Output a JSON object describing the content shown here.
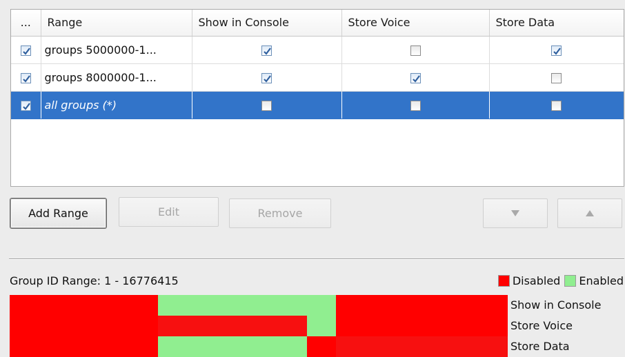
{
  "table": {
    "columns": [
      "...",
      "Range",
      "Show in Console",
      "Store Voice",
      "Store Data"
    ],
    "rows": [
      {
        "enabled": true,
        "range": "groups 5000000-1...",
        "show_in_console": true,
        "store_voice": false,
        "store_data": true,
        "selected": false
      },
      {
        "enabled": true,
        "range": "groups 8000000-1...",
        "show_in_console": true,
        "store_voice": true,
        "store_data": false,
        "selected": false
      },
      {
        "enabled": true,
        "range": "all groups (*)",
        "show_in_console": false,
        "store_voice": false,
        "store_data": false,
        "selected": true
      }
    ]
  },
  "buttons": {
    "add_range": "Add Range",
    "edit": "Edit",
    "remove": "Remove",
    "move_down_icon": "triangle-down",
    "move_up_icon": "triangle-up"
  },
  "range_map": {
    "label": "Group ID Range: 1 - 16776415",
    "legend_disabled": "Disabled",
    "legend_enabled": "Enabled",
    "colors": {
      "disabled": "#ff0000",
      "enabled": "#90ee90"
    },
    "rows": [
      {
        "name": "Show in Console",
        "segments": [
          {
            "from": 0.0,
            "to": 0.298,
            "state": "disabled"
          },
          {
            "from": 0.298,
            "to": 0.655,
            "state": "enabled"
          },
          {
            "from": 0.655,
            "to": 1.0,
            "state": "disabled"
          }
        ]
      },
      {
        "name": "Store Voice",
        "segments": [
          {
            "from": 0.0,
            "to": 0.298,
            "state": "disabled"
          },
          {
            "from": 0.298,
            "to": 0.476,
            "state": "disabled"
          },
          {
            "from": 0.476,
            "to": 0.597,
            "state": "disabled"
          },
          {
            "from": 0.597,
            "to": 0.655,
            "state": "enabled"
          },
          {
            "from": 0.655,
            "to": 1.0,
            "state": "disabled"
          }
        ]
      },
      {
        "name": "Store Data",
        "segments": [
          {
            "from": 0.0,
            "to": 0.298,
            "state": "disabled"
          },
          {
            "from": 0.298,
            "to": 0.597,
            "state": "enabled"
          },
          {
            "from": 0.597,
            "to": 0.655,
            "state": "disabled"
          },
          {
            "from": 0.655,
            "to": 1.0,
            "state": "disabled"
          }
        ]
      }
    ]
  }
}
